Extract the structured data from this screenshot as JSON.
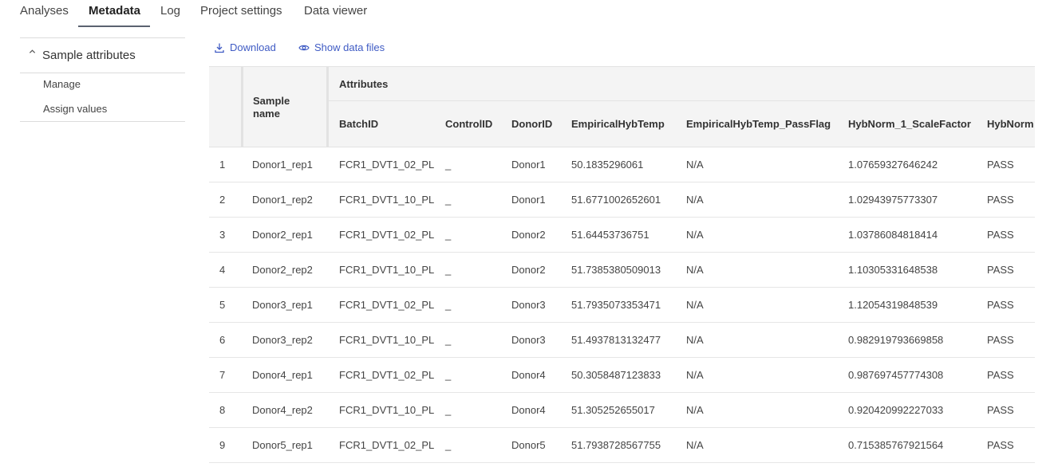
{
  "tabs": [
    {
      "label": "Analyses"
    },
    {
      "label": "Metadata"
    },
    {
      "label": "Log"
    },
    {
      "label": "Project settings"
    },
    {
      "label": "Data viewer"
    }
  ],
  "sidebar": {
    "section_title": "Sample attributes",
    "items": [
      {
        "label": "Manage"
      },
      {
        "label": "Assign values"
      }
    ]
  },
  "toolbar": {
    "download_label": "Download",
    "show_files_label": "Show data files"
  },
  "table": {
    "group_header": "Attributes",
    "sample_name_header": "Sample\nname",
    "columns": [
      "BatchID",
      "ControlID",
      "DonorID",
      "EmpiricalHybTemp",
      "EmpiricalHybTemp_PassFlag",
      "HybNorm_1_ScaleFactor",
      "HybNorm"
    ],
    "rows": [
      {
        "num": "1",
        "name": "Donor1_rep1",
        "cells": [
          "FCR1_DVT1_02_PL",
          "_",
          "Donor1",
          "50.1835296061",
          "N/A",
          "1.07659327646242",
          "PASS"
        ]
      },
      {
        "num": "2",
        "name": "Donor1_rep2",
        "cells": [
          "FCR1_DVT1_10_PL",
          "_",
          "Donor1",
          "51.6771002652601",
          "N/A",
          "1.02943975773307",
          "PASS"
        ]
      },
      {
        "num": "3",
        "name": "Donor2_rep1",
        "cells": [
          "FCR1_DVT1_02_PL",
          "_",
          "Donor2",
          "51.64453736751",
          "N/A",
          "1.03786084818414",
          "PASS"
        ]
      },
      {
        "num": "4",
        "name": "Donor2_rep2",
        "cells": [
          "FCR1_DVT1_10_PL",
          "_",
          "Donor2",
          "51.7385380509013",
          "N/A",
          "1.10305331648538",
          "PASS"
        ]
      },
      {
        "num": "5",
        "name": "Donor3_rep1",
        "cells": [
          "FCR1_DVT1_02_PL",
          "_",
          "Donor3",
          "51.7935073353471",
          "N/A",
          "1.12054319848539",
          "PASS"
        ]
      },
      {
        "num": "6",
        "name": "Donor3_rep2",
        "cells": [
          "FCR1_DVT1_10_PL",
          "_",
          "Donor3",
          "51.4937813132477",
          "N/A",
          "0.982919793669858",
          "PASS"
        ]
      },
      {
        "num": "7",
        "name": "Donor4_rep1",
        "cells": [
          "FCR1_DVT1_02_PL",
          "_",
          "Donor4",
          "50.3058487123833",
          "N/A",
          "0.987697457774308",
          "PASS"
        ]
      },
      {
        "num": "8",
        "name": "Donor4_rep2",
        "cells": [
          "FCR1_DVT1_10_PL",
          "_",
          "Donor4",
          "51.305252655017",
          "N/A",
          "0.920420992227033",
          "PASS"
        ]
      },
      {
        "num": "9",
        "name": "Donor5_rep1",
        "cells": [
          "FCR1_DVT1_02_PL",
          "_",
          "Donor5",
          "51.7938728567755",
          "N/A",
          "0.715385767921564",
          "PASS"
        ]
      }
    ]
  },
  "colors": {
    "link": "#3f5bc4",
    "header_bg": "#f4f4f4"
  }
}
